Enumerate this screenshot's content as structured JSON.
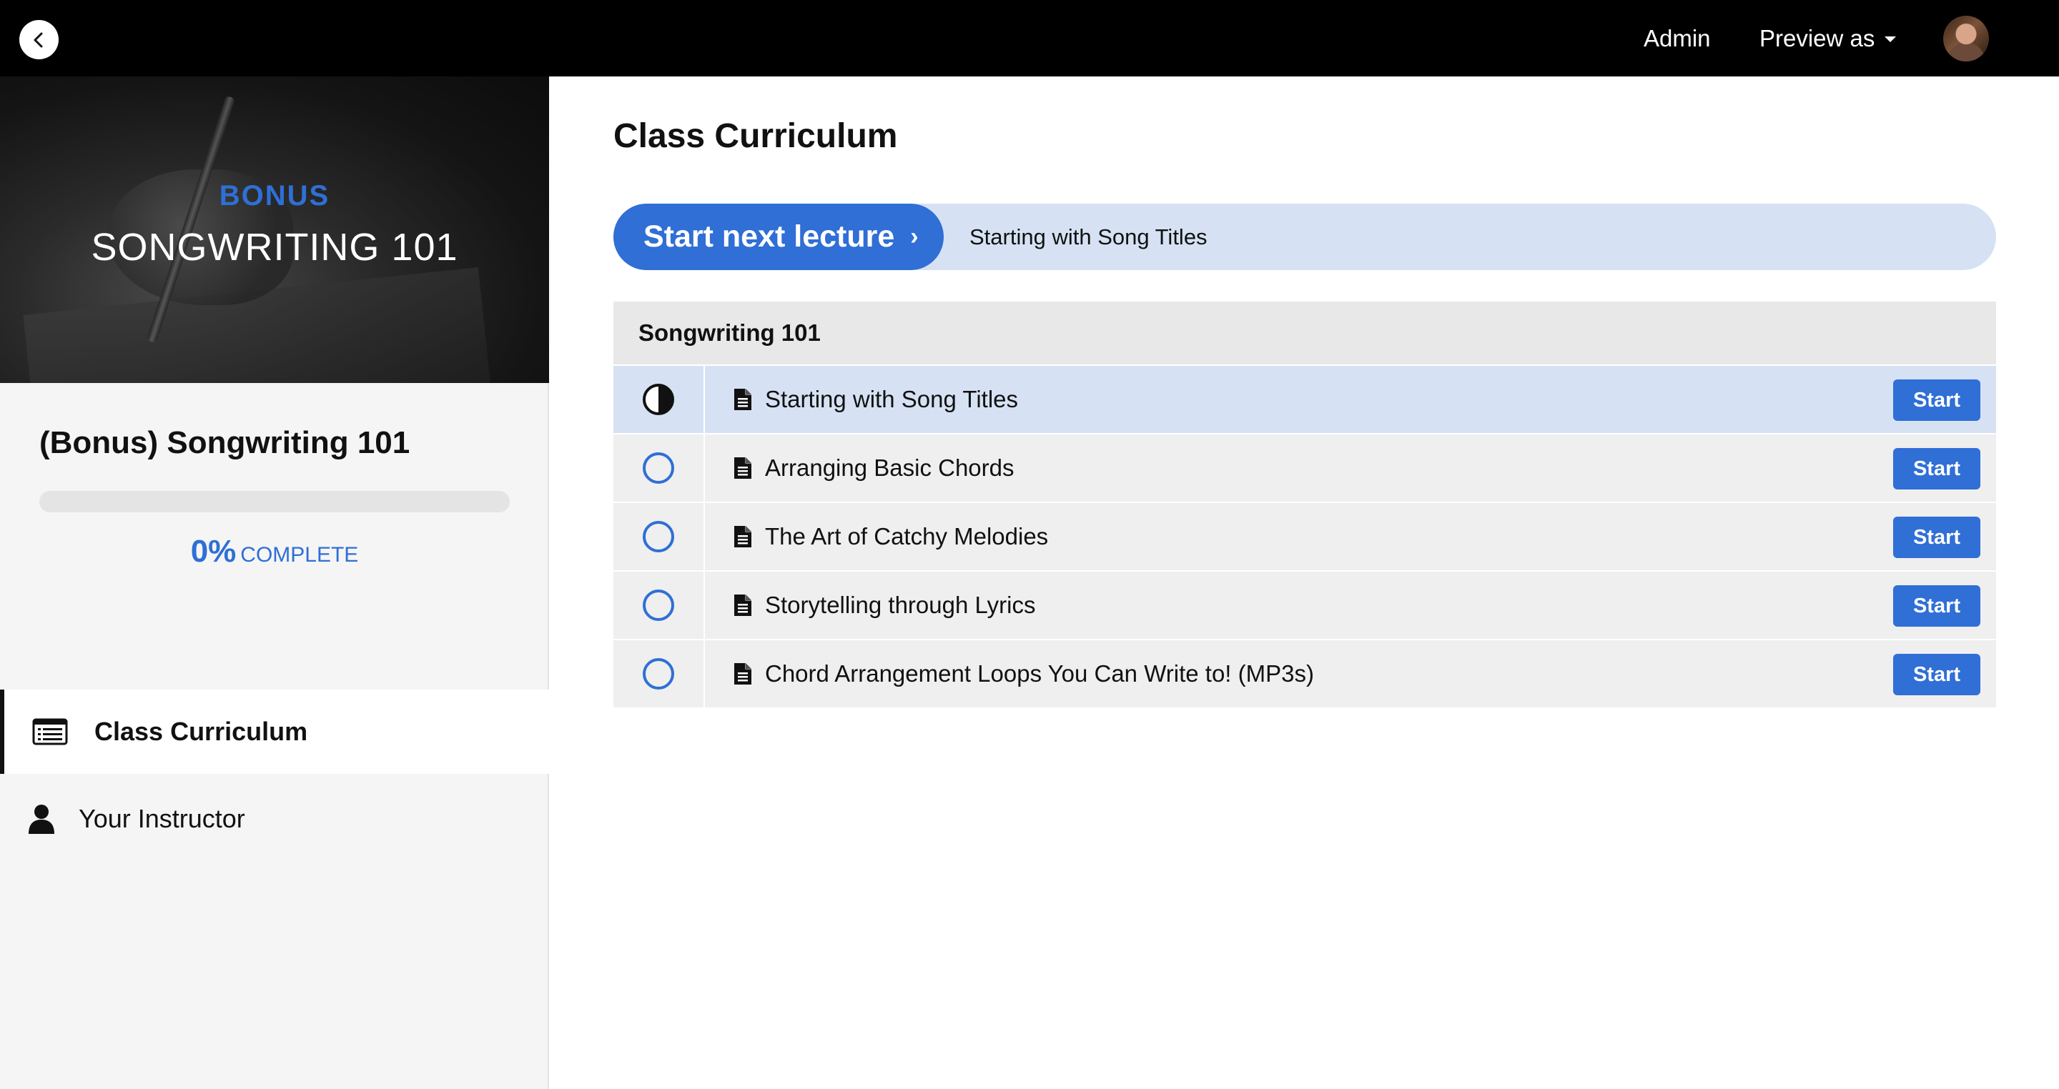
{
  "topbar": {
    "admin_label": "Admin",
    "preview_label": "Preview as"
  },
  "sidebar": {
    "hero": {
      "bonus": "BONUS",
      "title": "SONGWRITING 101"
    },
    "course_title": "(Bonus) Songwriting 101",
    "progress": {
      "percent": 0,
      "percent_label": "0%",
      "complete_label": "COMPLETE"
    },
    "nav": [
      {
        "label": "Class Curriculum",
        "icon": "curriculum-list-icon",
        "active": true
      },
      {
        "label": "Your Instructor",
        "icon": "user-icon",
        "active": false
      }
    ]
  },
  "main": {
    "title": "Class Curriculum",
    "next": {
      "button_label": "Start next lecture",
      "chevron": "›",
      "lecture_title": "Starting with Song Titles"
    },
    "section": {
      "title": "Songwriting 101",
      "lectures": [
        {
          "title": "Starting with Song Titles",
          "status": "in-progress",
          "button": "Start"
        },
        {
          "title": "Arranging Basic Chords",
          "status": "not-started",
          "button": "Start"
        },
        {
          "title": "The Art of Catchy Melodies",
          "status": "not-started",
          "button": "Start"
        },
        {
          "title": "Storytelling through Lyrics",
          "status": "not-started",
          "button": "Start"
        },
        {
          "title": "Chord Arrangement Loops You Can Write to! (MP3s)",
          "status": "not-started",
          "button": "Start"
        }
      ]
    }
  },
  "colors": {
    "accent": "#2f6fd6",
    "highlight": "#d6e2f4",
    "row": "#efefef",
    "topbar": "#000000"
  }
}
